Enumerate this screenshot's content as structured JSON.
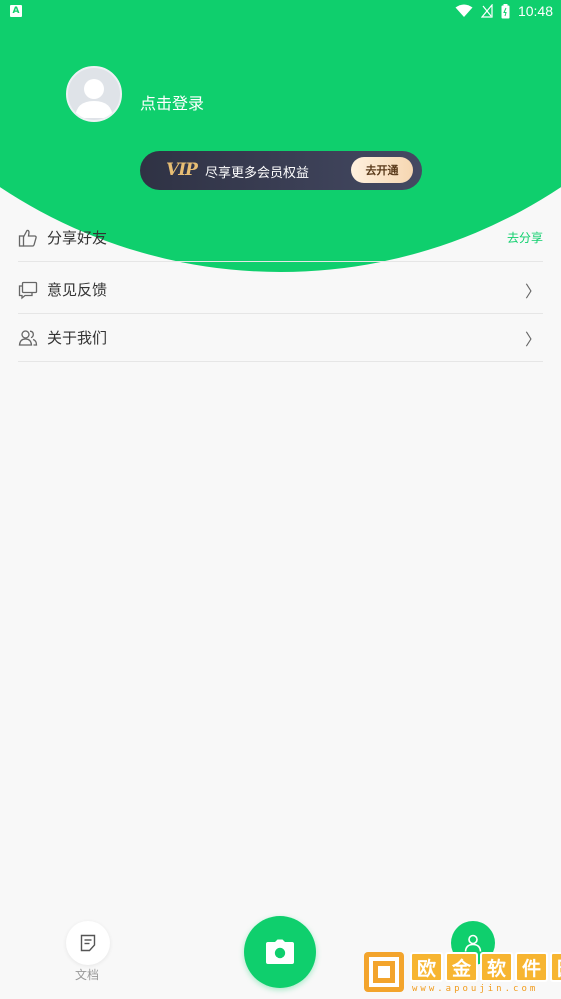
{
  "status_bar": {
    "app_icon_letter": "A",
    "time": "10:48"
  },
  "profile": {
    "login_prompt": "点击登录"
  },
  "vip": {
    "logo": "VIP",
    "tagline": "尽享更多会员权益",
    "cta": "去开通"
  },
  "menu": {
    "share": {
      "label": "分享好友",
      "action": "去分享",
      "icon": "thumbs-up-icon"
    },
    "feedback": {
      "label": "意见反馈",
      "chevron": "〉",
      "icon": "chat-icon"
    },
    "about": {
      "label": "关于我们",
      "chevron": "〉",
      "icon": "users-icon"
    }
  },
  "bottom_nav": {
    "docs_label": "文档",
    "docs_icon": "document-icon",
    "camera_icon": "camera-icon",
    "mine_icon": "user-icon"
  },
  "watermark": {
    "chars": [
      "欧",
      "金",
      "软",
      "件",
      "园"
    ],
    "url": "www.apoujin.com"
  },
  "colors": {
    "accent": "#0fcf6d",
    "vip_dark": "#2f3244",
    "vip_gold": "#e8be74",
    "background": "#f8f8f8"
  }
}
